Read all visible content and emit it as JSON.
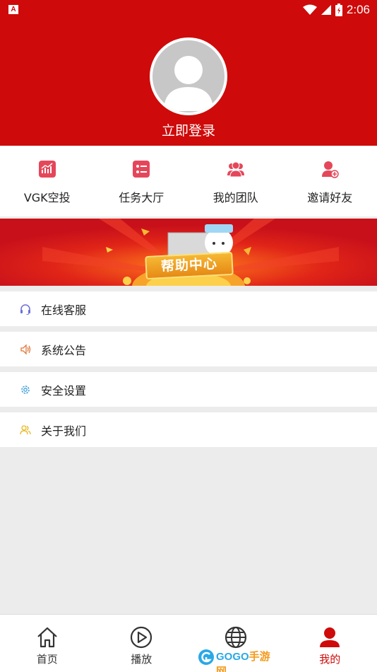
{
  "status_bar": {
    "left_badge": "A",
    "time": "2:06",
    "icons": [
      "wifi-icon",
      "signal-icon",
      "battery-icon"
    ]
  },
  "header": {
    "login_label": "立即登录",
    "avatar_icon": "user-avatar-icon",
    "background_color": "#cf0a0a"
  },
  "quick_menu": {
    "items": [
      {
        "label": "VGK空投",
        "icon": "chart-icon"
      },
      {
        "label": "任务大厅",
        "icon": "task-list-icon"
      },
      {
        "label": "我的团队",
        "icon": "team-icon"
      },
      {
        "label": "邀请好友",
        "icon": "add-friend-icon"
      }
    ]
  },
  "banner": {
    "label": "帮助中心"
  },
  "menu_list": {
    "items": [
      {
        "label": "在线客服",
        "icon": "headset-icon",
        "color": "#6b6fd8"
      },
      {
        "label": "系统公告",
        "icon": "speaker-icon",
        "color": "#e0783a"
      },
      {
        "label": "安全设置",
        "icon": "gear-icon",
        "color": "#3fa0d8"
      },
      {
        "label": "关于我们",
        "icon": "users-icon",
        "color": "#e8b820"
      }
    ]
  },
  "bottom_nav": {
    "items": [
      {
        "label": "首页",
        "icon": "home-icon",
        "active": false
      },
      {
        "label": "播放",
        "icon": "play-icon",
        "active": false
      },
      {
        "label": "",
        "icon": "globe-icon",
        "active": false
      },
      {
        "label": "我的",
        "icon": "person-icon",
        "active": true
      }
    ]
  },
  "watermark": {
    "brand": "GOGO",
    "brand_cn": "手游网"
  },
  "colors": {
    "accent": "#cf0a0a",
    "icon_red": "#e5475a"
  }
}
